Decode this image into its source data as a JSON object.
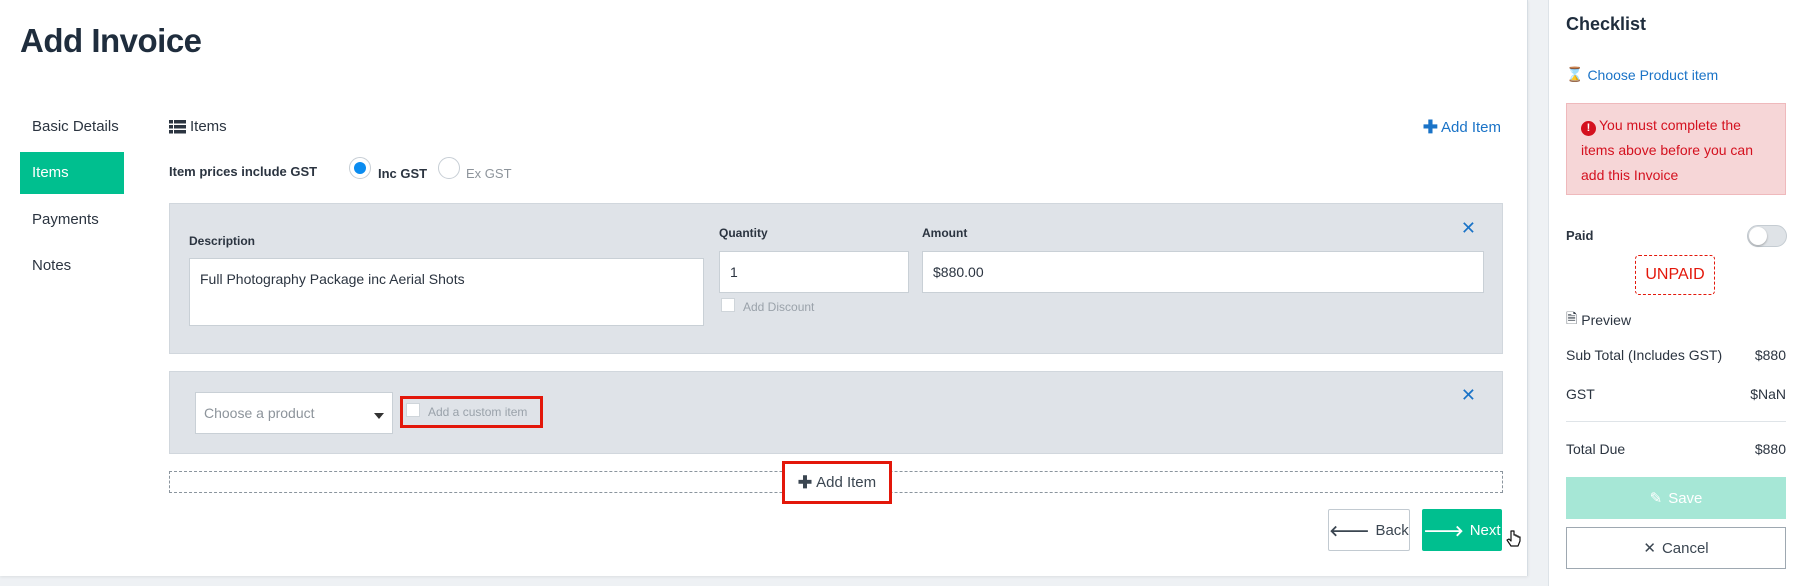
{
  "page": {
    "title": "Add Invoice"
  },
  "nav": {
    "items": [
      {
        "label": "Basic Details",
        "active": false
      },
      {
        "label": "Items",
        "active": true
      },
      {
        "label": "Payments",
        "active": false
      },
      {
        "label": "Notes",
        "active": false
      }
    ]
  },
  "items_section": {
    "title": "Items",
    "add_item_label": "Add Item",
    "gst_label": "Item prices include GST",
    "gst_options": [
      {
        "label": "Inc GST",
        "selected": true
      },
      {
        "label": "Ex GST",
        "selected": false
      }
    ]
  },
  "line_item": {
    "description_label": "Description",
    "description_value": "Full Photography Package inc Aerial Shots",
    "quantity_label": "Quantity",
    "quantity_value": "1",
    "amount_label": "Amount",
    "amount_value": "$880.00",
    "discount_label": "Add Discount"
  },
  "new_item": {
    "product_placeholder": "Choose a product",
    "custom_item_label": "Add a custom item"
  },
  "actions": {
    "add_item_label": "Add Item",
    "back_label": "Back",
    "next_label": "Next"
  },
  "checklist": {
    "title": "Checklist",
    "link_label": "Choose Product item",
    "alert_text": "You must complete the items above before you can add this Invoice",
    "paid_label": "Paid",
    "status": "UNPAID",
    "preview_label": "Preview",
    "subtotal_label": "Sub Total (Includes GST)",
    "subtotal_value": "$880",
    "gst_label": "GST",
    "gst_value": "$NaN",
    "total_label": "Total Due",
    "total_value": "$880",
    "save_label": "Save",
    "cancel_label": "Cancel"
  },
  "colors": {
    "accent": "#00bf8f",
    "link": "#1a73c7",
    "error": "#e3170a"
  }
}
